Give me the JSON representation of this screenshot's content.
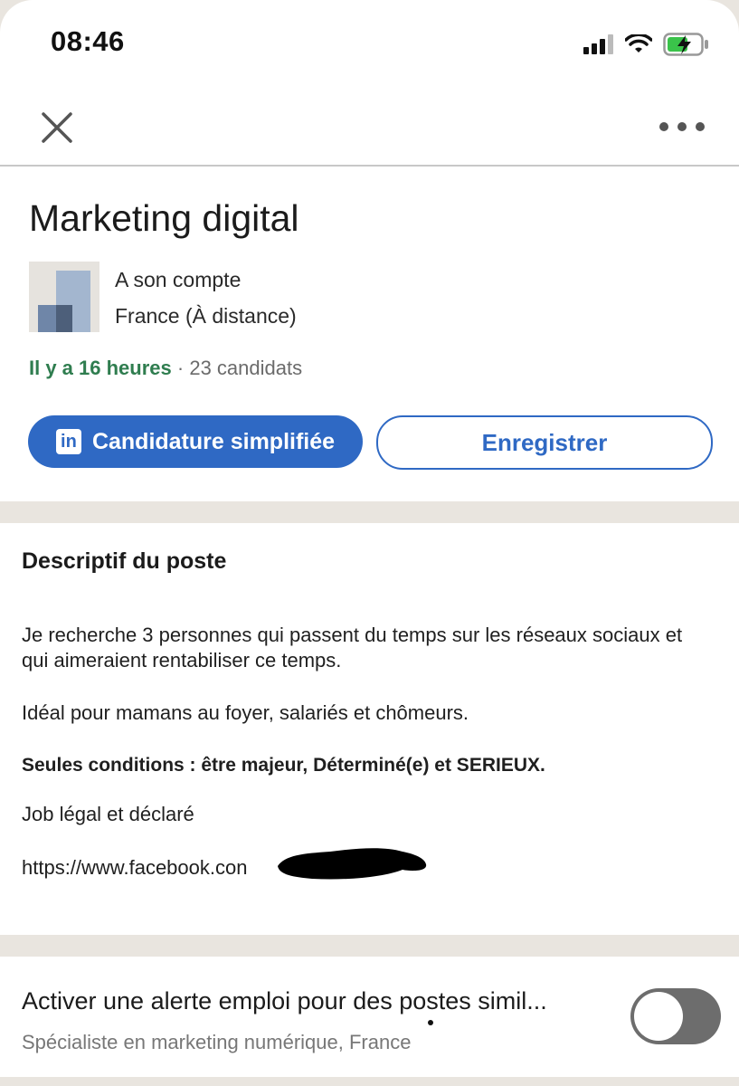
{
  "status_bar": {
    "time": "08:46"
  },
  "job": {
    "title": "Marketing digital",
    "company": "A son compte",
    "location": "France (À distance)",
    "posted": "Il y a 16 heures",
    "separator": "·",
    "applicants": "23 candidats"
  },
  "actions": {
    "apply_label": "Candidature simplifiée",
    "apply_icon_text": "in",
    "save_label": "Enregistrer"
  },
  "description": {
    "heading": "Descriptif du poste",
    "paragraphs": [
      "Je recherche 3 personnes qui passent du temps sur les réseaux sociaux et qui aimeraient rentabiliser ce temps.",
      "Idéal pour mamans au foyer, salariés et chômeurs.",
      "Seules conditions : être majeur, Déterminé(e) et SERIEUX.",
      "Job légal et déclaré",
      "https://www.facebook.con"
    ]
  },
  "alert": {
    "title": "Activer une alerte emploi pour des postes simil...",
    "subtitle": "Spécialiste en marketing numérique, France",
    "toggle_on": false
  },
  "colors": {
    "accent": "#2f69c4",
    "posted_green": "#2f7d4f",
    "separator_bg": "#e9e5df"
  }
}
